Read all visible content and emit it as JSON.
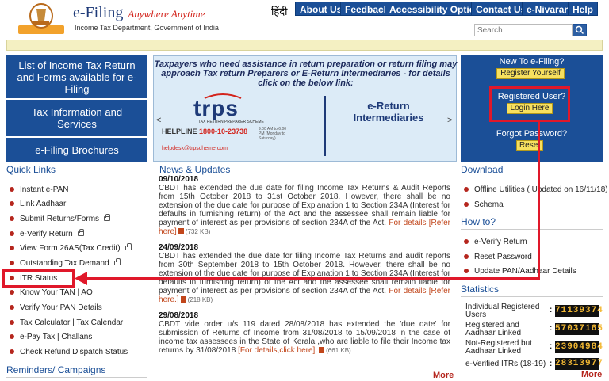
{
  "header": {
    "brand_title": "e-Filing",
    "brand_tagline": "Anywhere Anytime",
    "brand_subtitle": "Income Tax Department, Government of India",
    "language_link": "हिंदी",
    "top_nav": [
      "About Us",
      "Feedback",
      "Accessibility Options",
      "Contact Us",
      "e-Nivaran",
      "Help"
    ],
    "search_placeholder": "Search"
  },
  "left_panel": {
    "items": [
      "List of Income Tax Return and Forms available for e-Filing",
      "Tax Information and Services",
      "e-Filing Brochures"
    ]
  },
  "banner": {
    "text": "Taxpayers who need assistance in return preparation or return filing may approach Tax return Preparers or E-Return Intermediaries - for details click on the below link:",
    "brand": "trps",
    "brand_sub": "TAX RETURN PREPARER SCHEME",
    "helpline_label": "HELPLINE",
    "helpline_number": "1800-10-23738",
    "helpline_hours": "9:00 AM to 6:00 PM (Monday to Saturday)",
    "helpdesk": "helpdesk@trpscheme.com",
    "eri": "e-Return Intermediaries",
    "prev": "<",
    "next": ">"
  },
  "right_panel": {
    "new_label": "New To e-Filing?",
    "register_btn": "Register Yourself",
    "registered_label": "Registered User?",
    "login_btn": "Login Here",
    "forgot_label": "Forgot Password?",
    "reset_btn": "Reset"
  },
  "quick_links": {
    "title": "Quick Links",
    "items": [
      "Instant e-PAN",
      "Link Aadhaar",
      "Submit Returns/Forms",
      "e-Verify Return",
      "View Form 26AS(Tax Credit)",
      "Outstanding Tax Demand",
      "ITR Status",
      "Know Your TAN | AO",
      "Verify Your PAN Details",
      "Tax Calculator | Tax Calendar",
      "e-Pay Tax | Challans",
      "Check Refund Dispatch Status"
    ]
  },
  "reminders_title": "Reminders/ Campaigns",
  "news": {
    "title": "News & Updates",
    "items": [
      {
        "date": "09/10/2018",
        "body": "CBDT has extended the due date for filing Income Tax Returns & Audit Reports from 15th October 2018 to 31st October 2018. However, there shall be no extension of the due date for purpose of Explanation 1 to Section 234A (Interest for defaults in furnishing return) of the Act and the assessee shall remain liable for payment of interest as per provisions of section 234A of the Act.",
        "link": "For details [Refer here]",
        "size": "(732 KB)"
      },
      {
        "date": "24/09/2018",
        "body": "CBDT has extended the due date for filing Income Tax Returns and audit reports from 30th September 2018 to 15th October 2018. However, there shall be no extension of the due date for purpose of Explanation 1 to Section 234A (Interest for defaults in furnishing return) of the Act and the assessee shall remain liable for payment of interest as per provisions of section 234A of the Act.",
        "link": "For details [Refer here.]",
        "size": "(218 KB)"
      },
      {
        "date": "29/08/2018",
        "body": "CBDT vide order u/s 119 dated 28/08/2018 has extended the 'due date' for submission of Returns of Income from 31/08/2018 to 15/09/2018 in the case of income tax assessees in the State of Kerala ,who are liable to file their Income tax returns by 31/08/2018",
        "link": "[For details,click here].",
        "size": "(661 KB)"
      }
    ],
    "more": "More"
  },
  "download": {
    "title": "Download",
    "items": [
      "Offline  Utilities  ( Updated on 16/11/18)",
      "Schema"
    ]
  },
  "howto": {
    "title": "How to?",
    "items": [
      "e-Verify Return",
      "Reset Password",
      "Update PAN/Aadhaar Details"
    ]
  },
  "statistics": {
    "title": "Statistics",
    "rows": [
      {
        "label": "Individual Registered Users",
        "value": "71139374"
      },
      {
        "label": "Registered and Aadhaar Linked",
        "value": "57037165"
      },
      {
        "label": "Not-Registered but Aadhaar Linked",
        "value": "23904984"
      },
      {
        "label": "e-Verified ITRs (18-19)",
        "value": "28313977"
      }
    ],
    "more": "More"
  }
}
